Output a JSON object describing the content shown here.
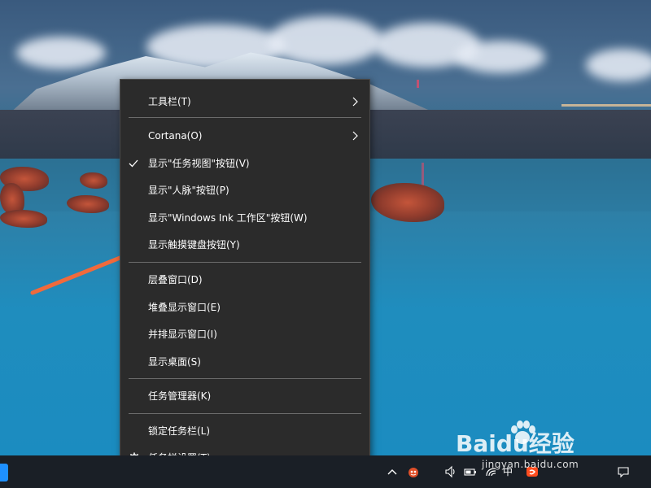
{
  "context_menu": {
    "items": [
      {
        "label": "工具栏(T)",
        "submenu": true
      },
      {
        "label": "Cortana(O)",
        "submenu": true
      },
      {
        "label": "显示\"任务视图\"按钮(V)",
        "checked": true
      },
      {
        "label": "显示\"人脉\"按钮(P)"
      },
      {
        "label": "显示\"Windows Ink 工作区\"按钮(W)"
      },
      {
        "label": "显示触摸键盘按钮(Y)"
      },
      {
        "label": "层叠窗口(D)"
      },
      {
        "label": "堆叠显示窗口(E)"
      },
      {
        "label": "并排显示窗口(I)"
      },
      {
        "label": "显示桌面(S)"
      },
      {
        "label": "任务管理器(K)"
      },
      {
        "label": "锁定任务栏(L)"
      },
      {
        "label": "任务栏设置(T)",
        "icon": "gear-icon"
      }
    ]
  },
  "taskbar": {
    "tray": {
      "ime_label": "中",
      "notification_icon": "notification-icon"
    }
  },
  "watermark": {
    "brand": "Baidu经验",
    "url": "jingyan.baidu.com"
  },
  "colors": {
    "menu_bg": "#2b2b2b",
    "menu_text": "#ffffff",
    "separator": "#6b6b6b",
    "annotation_arrow": "#f06a3c",
    "taskbar_bg": "#1a1f26"
  }
}
